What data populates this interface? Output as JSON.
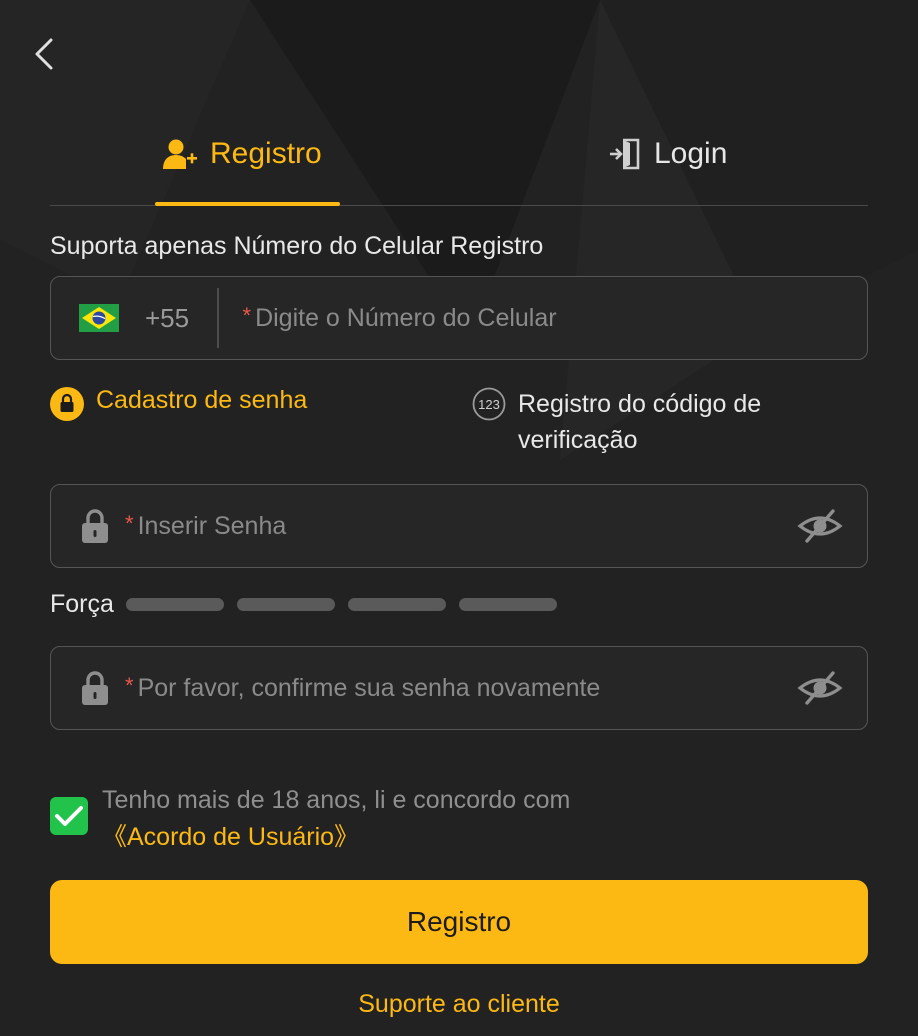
{
  "colors": {
    "accent": "#fdb913",
    "background": "#222222",
    "success": "#22c34a",
    "required": "#e8574a"
  },
  "tabs": [
    {
      "label": "Registro",
      "icon": "user-add-icon",
      "active": true
    },
    {
      "label": "Login",
      "icon": "login-door-icon",
      "active": false
    }
  ],
  "form": {
    "support_text": "Suporta apenas Número do Celular Registro",
    "country_code": "+55",
    "country_flag": "brazil-flag-icon",
    "required_mark": "*",
    "phone_placeholder": "Digite o Número do Celular",
    "methods": [
      {
        "label": "Cadastro de senha",
        "icon": "lock-badge-icon",
        "active": true
      },
      {
        "label": "Registro do código de verificação",
        "icon": "numeric-123-icon",
        "active": false
      }
    ],
    "password_placeholder": "Inserir Senha",
    "strength_label": "Força",
    "confirm_placeholder": "Por favor, confirme sua senha novamente"
  },
  "agreement": {
    "checked": true,
    "text": "Tenho mais de 18 anos, li e concordo com ",
    "link": "《Acordo de Usuário》"
  },
  "submit_label": "Registro",
  "support_link": "Suporte ao cliente"
}
